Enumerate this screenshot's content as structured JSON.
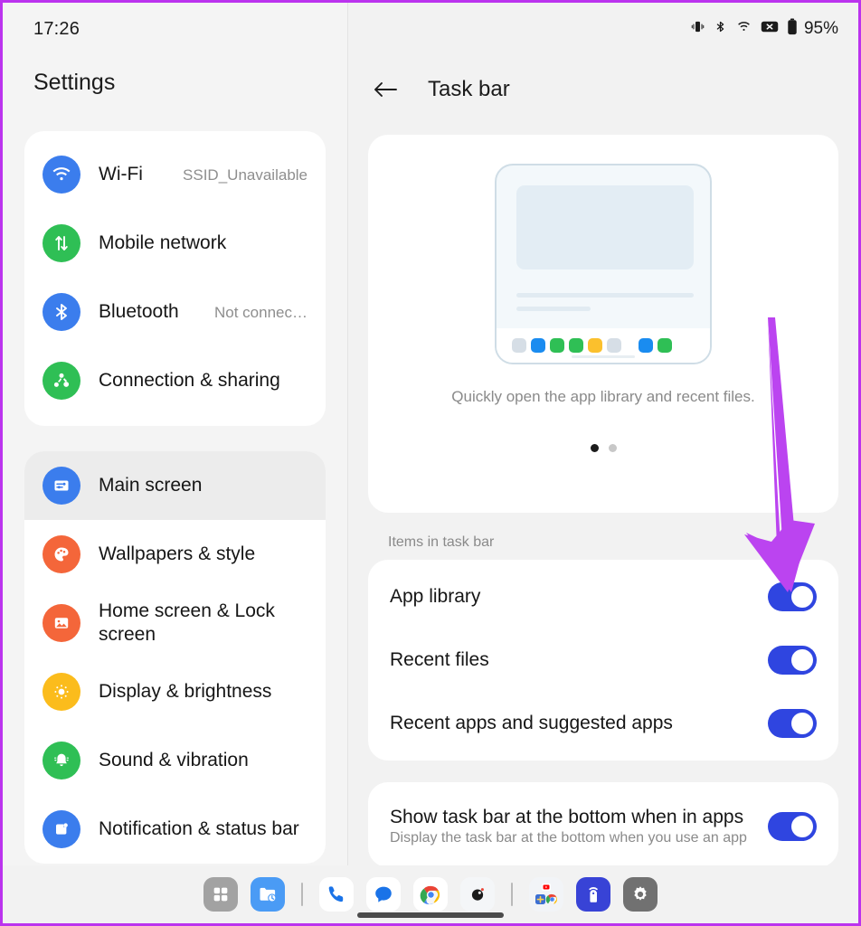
{
  "window": {
    "border_color": "#bb33ee",
    "background": "#f2f2f2"
  },
  "status_bar": {
    "clock": "17:26",
    "icons": [
      "vibrate-icon",
      "bluetooth-icon",
      "wifi-icon",
      "no-sim-icon",
      "battery-icon"
    ],
    "battery_label": "95%"
  },
  "sidebar": {
    "title": "Settings",
    "groups": [
      {
        "name": "network-group",
        "items": [
          {
            "label": "Wi-Fi",
            "value": "SSID_Unavailable",
            "icon": "wifi-icon",
            "icon_color": "#3b7ded",
            "selected": false
          },
          {
            "label": "Mobile network",
            "value": "",
            "icon": "mobile-network-icon",
            "icon_color": "#2fbf55",
            "selected": false
          },
          {
            "label": "Bluetooth",
            "value": "Not connec…",
            "icon": "bluetooth-icon",
            "icon_color": "#3b7ded",
            "selected": false
          },
          {
            "label": "Connection & sharing",
            "value": "",
            "icon": "connection-sharing-icon",
            "icon_color": "#2fbf55",
            "selected": false
          }
        ]
      },
      {
        "name": "system-group",
        "items": [
          {
            "label": "Main screen",
            "value": "",
            "icon": "sliders-icon",
            "icon_color": "#3b7ded",
            "selected": true
          },
          {
            "label": "Wallpapers & style",
            "value": "",
            "icon": "palette-icon",
            "icon_color": "#f4663a",
            "selected": false
          },
          {
            "label": "Home screen & Lock screen",
            "value": "",
            "icon": "image-icon",
            "icon_color": "#f4663a",
            "selected": false
          },
          {
            "label": "Display & brightness",
            "value": "",
            "icon": "brightness-icon",
            "icon_color": "#fbbc1c",
            "selected": false
          },
          {
            "label": "Sound & vibration",
            "value": "",
            "icon": "bell-icon",
            "icon_color": "#2fbf55",
            "selected": false
          },
          {
            "label": "Notification & status bar",
            "value": "",
            "icon": "notification-icon",
            "icon_color": "#3b7ded",
            "selected": false
          }
        ]
      }
    ]
  },
  "main": {
    "back_icon": "back-arrow-icon",
    "title": "Task bar",
    "preview": {
      "caption": "Quickly open the app library and recent files.",
      "dots": [
        {
          "active": true
        },
        {
          "active": false
        }
      ],
      "mock_chips": [
        "#d6dee6",
        "#1a8cf0",
        "#2fbf55",
        "#2fbf55",
        "#fbc02d",
        "#d6dee6",
        "gap",
        "#1a8cf0",
        "#2fbf55"
      ]
    },
    "items_section_label": "Items in task bar",
    "items": [
      {
        "title": "App library",
        "subtitle": "",
        "enabled": true
      },
      {
        "title": "Recent files",
        "subtitle": "",
        "enabled": true
      },
      {
        "title": "Recent apps and suggested apps",
        "subtitle": "",
        "enabled": true
      }
    ],
    "bottom_items": [
      {
        "title": "Show task bar at the bottom when in apps",
        "subtitle": "Display the task bar at the bottom when you use an app",
        "enabled": true
      }
    ]
  },
  "annotation": {
    "arrow_color": "#bb44f0",
    "points_to": "App library toggle"
  },
  "dock": {
    "items": [
      {
        "icon": "app-library-grid-icon",
        "name": "app-library"
      },
      {
        "icon": "recent-files-folder-icon",
        "name": "recent-files"
      },
      {
        "icon": "separator",
        "name": "dock-separator-1"
      },
      {
        "icon": "phone-icon",
        "name": "phone-app"
      },
      {
        "icon": "messages-icon",
        "name": "messages-app"
      },
      {
        "icon": "chrome-icon",
        "name": "chrome-app"
      },
      {
        "icon": "camera-icon",
        "name": "camera-app"
      },
      {
        "icon": "separator",
        "name": "dock-separator-2"
      },
      {
        "icon": "app-folder-icon",
        "name": "app-folder"
      },
      {
        "icon": "hotspot-icon",
        "name": "hotspot-app"
      },
      {
        "icon": "gear-icon",
        "name": "settings-app"
      }
    ]
  }
}
